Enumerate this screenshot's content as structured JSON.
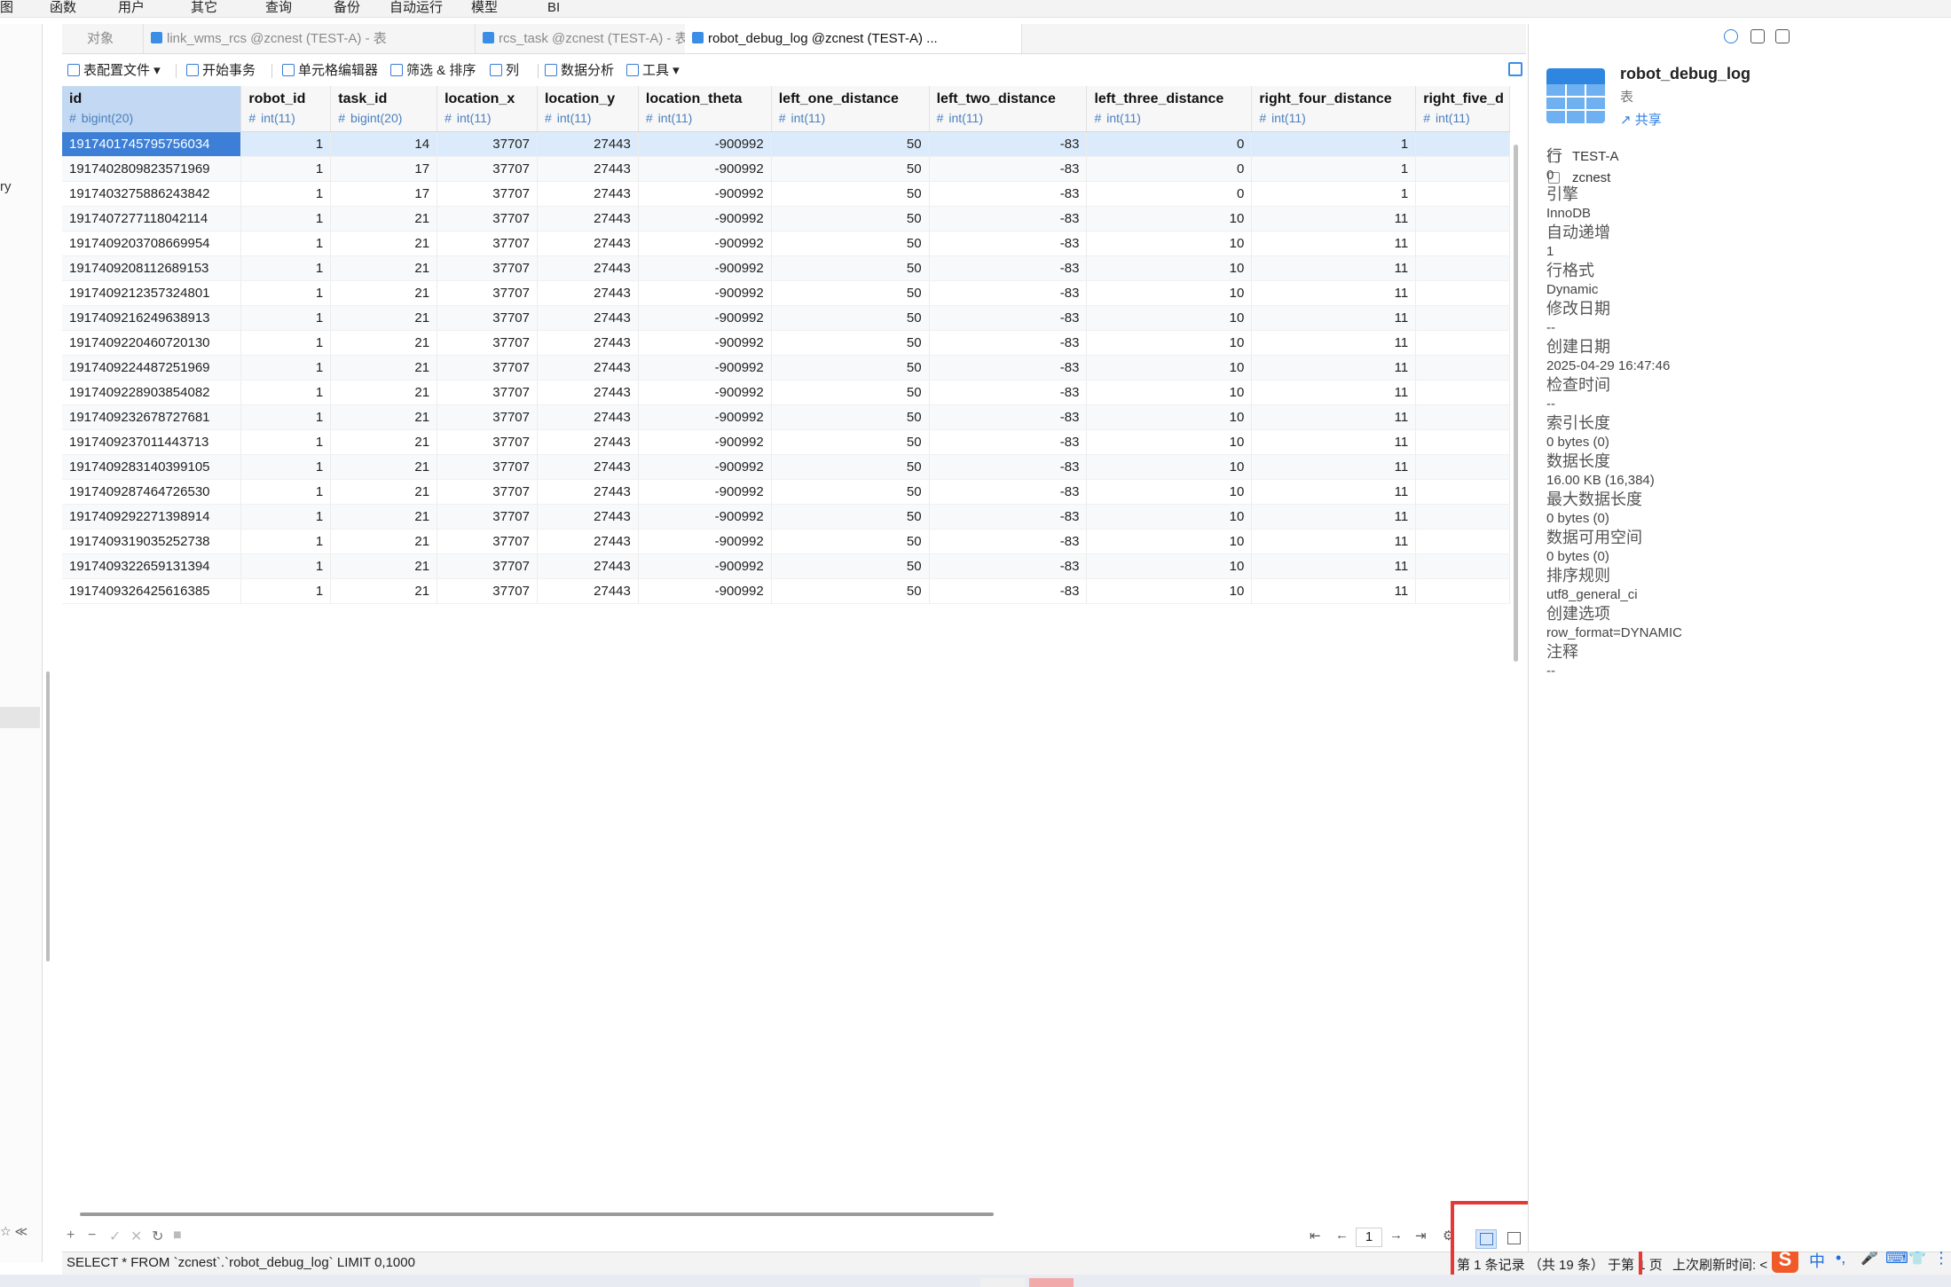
{
  "menu": [
    "图",
    "函数",
    "用户",
    "其它",
    "查询",
    "备份",
    "自动运行",
    "模型",
    "BI"
  ],
  "sidebar": {
    "fragment": "ry",
    "bottom_icons": "☆ ≪"
  },
  "tabs": [
    {
      "label": "对象",
      "active": false
    },
    {
      "label": "link_wms_rcs @zcnest (TEST-A) - 表",
      "active": false
    },
    {
      "label": "rcs_task @zcnest (TEST-A) - 表",
      "active": false
    },
    {
      "label": "robot_debug_log @zcnest (TEST-A) ...",
      "active": true
    }
  ],
  "toolbar": {
    "config": "表配置文件",
    "begin_tx": "开始事务",
    "cell_editor": "单元格编辑器",
    "filter_sort": "筛选 & 排序",
    "columns": "列",
    "analysis": "数据分析",
    "tools": "工具"
  },
  "grid": {
    "columns": [
      {
        "name": "id",
        "type": "bigint(20)"
      },
      {
        "name": "robot_id",
        "type": "int(11)"
      },
      {
        "name": "task_id",
        "type": "bigint(20)"
      },
      {
        "name": "location_x",
        "type": "int(11)"
      },
      {
        "name": "location_y",
        "type": "int(11)"
      },
      {
        "name": "location_theta",
        "type": "int(11)"
      },
      {
        "name": "left_one_distance",
        "type": "int(11)"
      },
      {
        "name": "left_two_distance",
        "type": "int(11)"
      },
      {
        "name": "left_three_distance",
        "type": "int(11)"
      },
      {
        "name": "right_four_distance",
        "type": "int(11)"
      },
      {
        "name": "right_five_d",
        "type": "int(11)"
      }
    ],
    "rows": [
      [
        "1917401745795756034",
        "1",
        "14",
        "37707",
        "27443",
        "-900992",
        "50",
        "-83",
        "0",
        "1",
        ""
      ],
      [
        "1917402809823571969",
        "1",
        "17",
        "37707",
        "27443",
        "-900992",
        "50",
        "-83",
        "0",
        "1",
        ""
      ],
      [
        "1917403275886243842",
        "1",
        "17",
        "37707",
        "27443",
        "-900992",
        "50",
        "-83",
        "0",
        "1",
        ""
      ],
      [
        "1917407277118042114",
        "1",
        "21",
        "37707",
        "27443",
        "-900992",
        "50",
        "-83",
        "10",
        "11",
        ""
      ],
      [
        "1917409203708669954",
        "1",
        "21",
        "37707",
        "27443",
        "-900992",
        "50",
        "-83",
        "10",
        "11",
        ""
      ],
      [
        "1917409208112689153",
        "1",
        "21",
        "37707",
        "27443",
        "-900992",
        "50",
        "-83",
        "10",
        "11",
        ""
      ],
      [
        "1917409212357324801",
        "1",
        "21",
        "37707",
        "27443",
        "-900992",
        "50",
        "-83",
        "10",
        "11",
        ""
      ],
      [
        "1917409216249638913",
        "1",
        "21",
        "37707",
        "27443",
        "-900992",
        "50",
        "-83",
        "10",
        "11",
        ""
      ],
      [
        "1917409220460720130",
        "1",
        "21",
        "37707",
        "27443",
        "-900992",
        "50",
        "-83",
        "10",
        "11",
        ""
      ],
      [
        "1917409224487251969",
        "1",
        "21",
        "37707",
        "27443",
        "-900992",
        "50",
        "-83",
        "10",
        "11",
        ""
      ],
      [
        "1917409228903854082",
        "1",
        "21",
        "37707",
        "27443",
        "-900992",
        "50",
        "-83",
        "10",
        "11",
        ""
      ],
      [
        "1917409232678727681",
        "1",
        "21",
        "37707",
        "27443",
        "-900992",
        "50",
        "-83",
        "10",
        "11",
        ""
      ],
      [
        "1917409237011443713",
        "1",
        "21",
        "37707",
        "27443",
        "-900992",
        "50",
        "-83",
        "10",
        "11",
        ""
      ],
      [
        "1917409283140399105",
        "1",
        "21",
        "37707",
        "27443",
        "-900992",
        "50",
        "-83",
        "10",
        "11",
        ""
      ],
      [
        "1917409287464726530",
        "1",
        "21",
        "37707",
        "27443",
        "-900992",
        "50",
        "-83",
        "10",
        "11",
        ""
      ],
      [
        "1917409292271398914",
        "1",
        "21",
        "37707",
        "27443",
        "-900992",
        "50",
        "-83",
        "10",
        "11",
        ""
      ],
      [
        "1917409319035252738",
        "1",
        "21",
        "37707",
        "27443",
        "-900992",
        "50",
        "-83",
        "10",
        "11",
        ""
      ],
      [
        "1917409322659131394",
        "1",
        "21",
        "37707",
        "27443",
        "-900992",
        "50",
        "-83",
        "10",
        "11",
        ""
      ],
      [
        "1917409326425616385",
        "1",
        "21",
        "37707",
        "27443",
        "-900992",
        "50",
        "-83",
        "10",
        "11",
        ""
      ]
    ]
  },
  "bottom": {
    "add": "+",
    "remove": "−",
    "apply": "✓",
    "discard": "✕",
    "refresh": "↻",
    "stop": "■",
    "first": "⇤",
    "prev": "←",
    "page": "1",
    "next": "→",
    "last": "⇥",
    "gear": "⚙"
  },
  "status": {
    "sql": "SELECT * FROM `zcnest`.`robot_debug_log` LIMIT 0,1000",
    "records": "第 1 条记录 （共 19 条） 于第 1 页",
    "refresh": "上次刷新时间: <"
  },
  "ime": {
    "logo": "S",
    "zh": "中",
    "punct": "•,",
    "mic": "🎤",
    "kbd": "⌨",
    "skin": "👕",
    "grid": "⋮⋮"
  },
  "panel": {
    "title": "robot_debug_log",
    "subtitle": "表",
    "share": "共享",
    "connection": "TEST-A",
    "database": "zcnest",
    "properties": [
      {
        "label": "行",
        "value": "0"
      },
      {
        "label": "引擎",
        "value": "InnoDB"
      },
      {
        "label": "自动递增",
        "value": "1"
      },
      {
        "label": "行格式",
        "value": "Dynamic"
      },
      {
        "label": "修改日期",
        "value": "--"
      },
      {
        "label": "创建日期",
        "value": "2025-04-29 16:47:46"
      },
      {
        "label": "检查时间",
        "value": "--"
      },
      {
        "label": "索引长度",
        "value": "0 bytes (0)"
      },
      {
        "label": "数据长度",
        "value": "16.00 KB (16,384)"
      },
      {
        "label": "最大数据长度",
        "value": "0 bytes (0)"
      },
      {
        "label": "数据可用空间",
        "value": "0 bytes (0)"
      },
      {
        "label": "排序规则",
        "value": "utf8_general_ci"
      },
      {
        "label": "创建选项",
        "value": "row_format=DYNAMIC"
      },
      {
        "label": "注释",
        "value": "--"
      }
    ]
  }
}
